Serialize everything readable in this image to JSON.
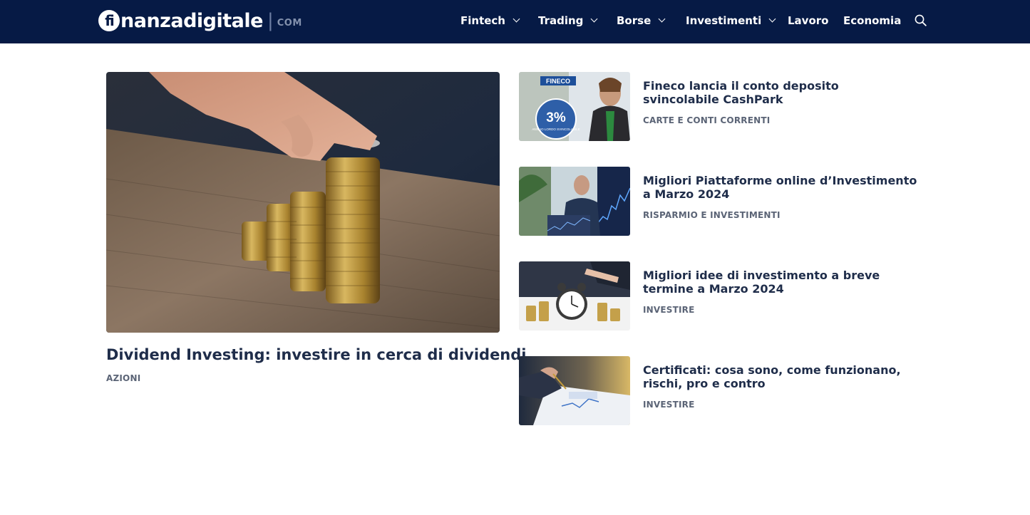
{
  "site": {
    "logo_badge": "fi",
    "logo_name": "nanzadigitale",
    "logo_sep": "|",
    "logo_tld": "COM"
  },
  "nav": {
    "items": [
      {
        "label": "Fintech",
        "has_dropdown": true
      },
      {
        "label": "Trading",
        "has_dropdown": true
      },
      {
        "label": "Borse",
        "has_dropdown": true
      },
      {
        "label": "Investimenti",
        "has_dropdown": true
      },
      {
        "label": "Lavoro",
        "has_dropdown": false
      },
      {
        "label": "Economia",
        "has_dropdown": false
      }
    ],
    "search_icon": "search-icon"
  },
  "featured": {
    "title": "Dividend Investing: investire in cerca di dividendi",
    "category": "AZIONI",
    "image": "coin-stacks-photo"
  },
  "articles": [
    {
      "title": "Fineco lancia il conto deposito svincolabile CashPark",
      "category": "CARTE E CONTI CORRENTI",
      "thumb": {
        "badge": "FINECO",
        "rate": "3%",
        "caption": "ANNUO LORDO SVINCOLABILE"
      }
    },
    {
      "title": "Migliori Piattaforme online d’Investimento a Marzo 2024",
      "category": "RISPARMIO E INVESTIMENTI",
      "thumb": {
        "image": "trader-with-charts-photo"
      }
    },
    {
      "title": "Migliori idee di investimento a breve termine a Marzo 2024",
      "category": "INVESTIRE",
      "thumb": {
        "image": "alarm-clock-coins-photo"
      }
    },
    {
      "title": "Certificati: cosa sono, come funzionano, rischi, pro e contro",
      "category": "INVESTIRE",
      "thumb": {
        "image": "signing-documents-photo"
      }
    }
  ],
  "colors": {
    "header_bg": "#061a45",
    "title_text": "#1f2d4a",
    "category_text": "#5b6476"
  }
}
